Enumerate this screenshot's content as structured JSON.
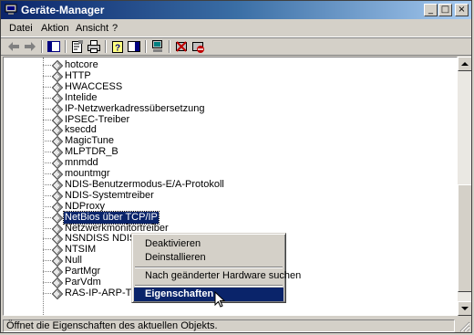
{
  "window": {
    "title": "Geräte-Manager",
    "controls": [
      "_",
      "□",
      "×"
    ]
  },
  "menu": [
    "Datei",
    "Aktion",
    "Ansicht",
    "?"
  ],
  "toolbar": {
    "buttons": [
      "back-arrow-icon",
      "forward-arrow-icon",
      "show-hide-tree-icon",
      "properties-icon",
      "print-icon",
      "help-icon",
      "console-tree-icon",
      "scan-hardware-icon",
      "uninstall-icon",
      "disable-icon"
    ]
  },
  "tree": {
    "items": [
      "hotcore",
      "HTTP",
      "HWACCESS",
      "Intelide",
      "IP-Netzwerkadressübersetzung",
      "IPSEC-Treiber",
      "ksecdd",
      "MagicTune",
      "MLPTDR_B",
      "mnmdd",
      "mountmgr",
      "NDIS-Benutzermodus-E/A-Protokoll",
      "NDIS-Systemtreiber",
      "NDProxy",
      "NetBios über TCP/IP",
      "Netzwerkmonitortreiber",
      "NSNDISS NDIS Protocol Driver",
      "NTSIM",
      "Null",
      "PartMgr",
      "ParVdm",
      "RAS-IP-ARP-Treiber"
    ],
    "selected": "NetBios über TCP/IP"
  },
  "context_menu": {
    "items": [
      "Deaktivieren",
      "Deinstallieren",
      "Nach geänderter Hardware suchen",
      "Eigenschaften"
    ],
    "highlighted": "Eigenschaften"
  },
  "status": {
    "text": "Öffnet die Eigenschaften des aktuellen Objekts."
  },
  "colors": {
    "title_start": "#0a246a",
    "title_end": "#a6caf0",
    "selection": "#0a246a",
    "face": "#d4d0c8"
  }
}
